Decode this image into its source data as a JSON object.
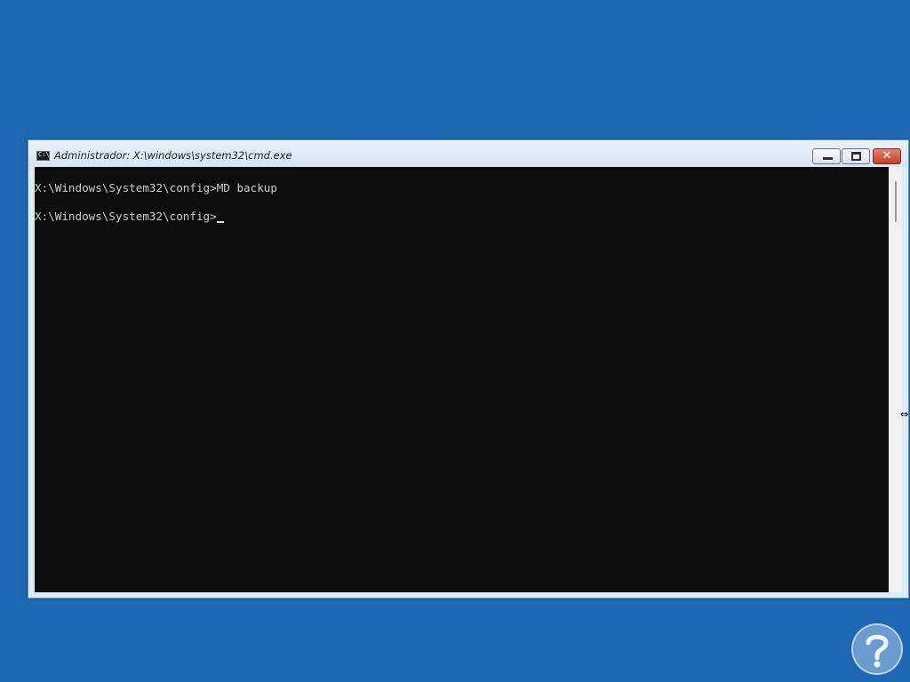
{
  "window": {
    "title": "Administrador: X:\\windows\\system32\\cmd.exe",
    "icon": "cmd-icon",
    "icon_text": "C:\\",
    "controls": {
      "minimize": "minimize-icon",
      "maximize": "maximize-icon",
      "close": "close-icon",
      "close_glyph": "✕"
    }
  },
  "console": {
    "lines": [
      "X:\\Windows\\System32\\config>MD backup",
      "X:\\Windows\\System32\\config>"
    ]
  },
  "colors": {
    "desktop": "#1e67b3",
    "console_bg": "#0c0c0c",
    "console_text": "#cccccc",
    "close_button": "#c3422c"
  },
  "watermark": {
    "icon": "question-mark-logo"
  }
}
